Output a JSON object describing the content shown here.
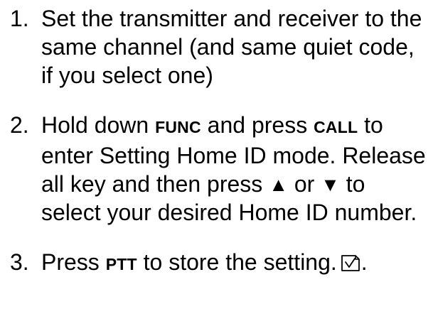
{
  "steps": [
    {
      "number": "1.",
      "text": "Set the transmitter and receiver to the same channel (and same quiet code, if you select one)"
    },
    {
      "number": "2.",
      "t1": "Hold down ",
      "key1": "FUNC",
      "t2": " and press ",
      "key2": "CALL",
      "t3": " to enter Setting Home ID mode. Release all key and then press ",
      "up": "▲",
      "t4": " or ",
      "down": "▼",
      "t5": " to select your desired Home ID number."
    },
    {
      "number": "3.",
      "t1": "Press ",
      "key1": "PTT",
      "t2": " to store the setting.",
      "icon": "store-setting-icon",
      "t3": "."
    }
  ]
}
